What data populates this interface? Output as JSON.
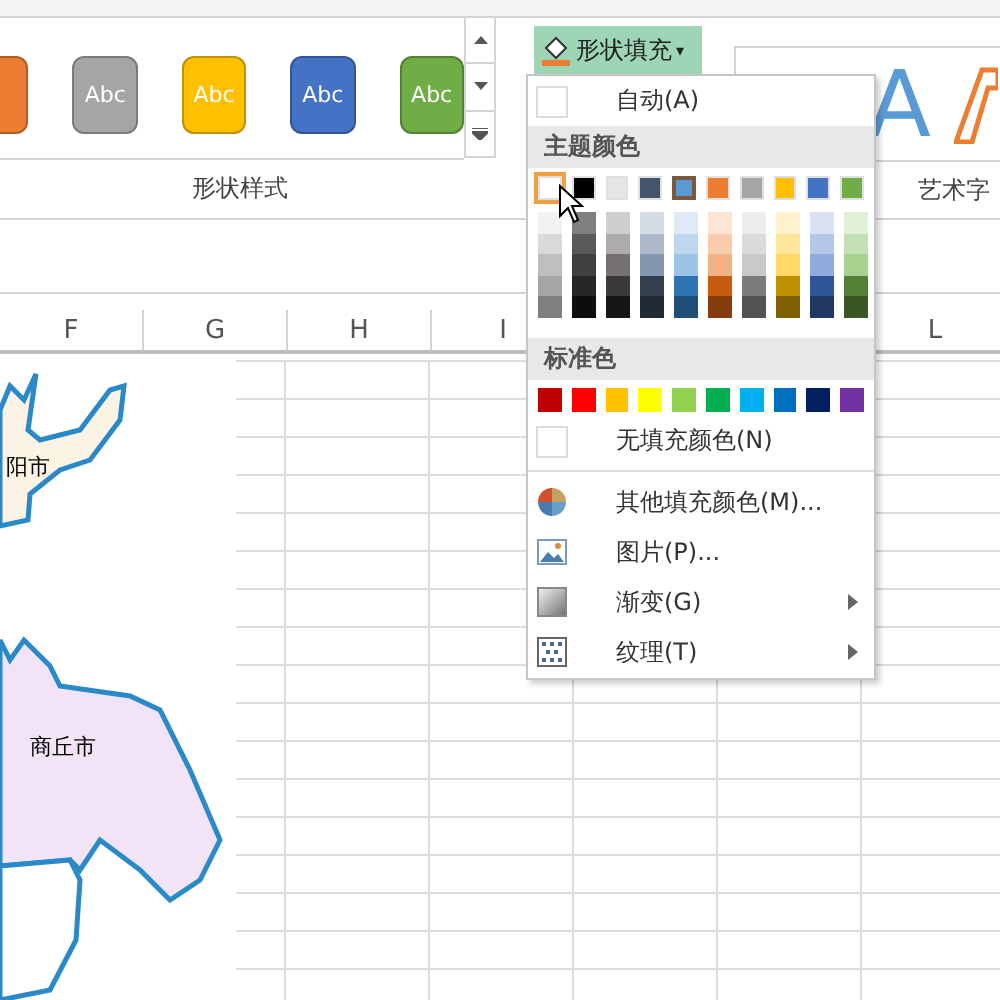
{
  "ribbon": {
    "style_gallery": [
      {
        "color": "#ed7d31"
      },
      {
        "color": "#a5a5a5",
        "label": "Abc"
      },
      {
        "color": "#ffc000",
        "label": "Abc"
      },
      {
        "color": "#4472c4",
        "label": "Abc"
      },
      {
        "color": "#70ad47",
        "label": "Abc"
      }
    ],
    "shape_styles_label": "形状样式",
    "fill_button": {
      "label": "形状填充",
      "caret": "▾",
      "expanded": true
    },
    "wordart": [
      {
        "label": "A",
        "color": "#5b9bd5"
      },
      {
        "color": "#ed7d31"
      }
    ],
    "wordart_label": "艺术字"
  },
  "sheet": {
    "columns": [
      {
        "label": "F"
      },
      {
        "label": "G"
      },
      {
        "label": "H"
      },
      {
        "label": "I"
      },
      {},
      {},
      {
        "label": "L"
      }
    ],
    "map_labels": [
      "阳市",
      "商丘市"
    ]
  },
  "fill_menu": {
    "auto": "自动(A)",
    "theme_header": "主题颜色",
    "theme_colors": [
      {
        "color": "#ffffff",
        "selected": true,
        "current": false,
        "shades": [
          {
            "color": "#f2f2f2"
          },
          {
            "color": "#d9d9d9"
          },
          {
            "color": "#bfbfbf"
          },
          {
            "color": "#a6a6a6"
          },
          {
            "color": "#808080"
          }
        ]
      },
      {
        "color": "#000000",
        "selected": false,
        "current": false,
        "shades": [
          {
            "color": "#7f7f7f"
          },
          {
            "color": "#595959"
          },
          {
            "color": "#404040"
          },
          {
            "color": "#262626"
          },
          {
            "color": "#0d0d0d"
          }
        ]
      },
      {
        "color": "#e7e6e6",
        "selected": false,
        "current": false,
        "shades": [
          {
            "color": "#d0cece"
          },
          {
            "color": "#aeabab"
          },
          {
            "color": "#757171"
          },
          {
            "color": "#3b3838"
          },
          {
            "color": "#171616"
          }
        ]
      },
      {
        "color": "#44546a",
        "selected": false,
        "current": false,
        "shades": [
          {
            "color": "#d6dce4"
          },
          {
            "color": "#adb9ca"
          },
          {
            "color": "#8497b0"
          },
          {
            "color": "#333f4f"
          },
          {
            "color": "#222a35"
          }
        ]
      },
      {
        "color": "#5b9bd5",
        "selected": false,
        "current": true,
        "shades": [
          {
            "color": "#deebf6"
          },
          {
            "color": "#bdd7ee"
          },
          {
            "color": "#9dc3e6"
          },
          {
            "color": "#2e75b5"
          },
          {
            "color": "#1f4e79"
          }
        ]
      },
      {
        "color": "#ed7d31",
        "selected": false,
        "current": false,
        "shades": [
          {
            "color": "#fbe5d5"
          },
          {
            "color": "#f7cbac"
          },
          {
            "color": "#f4b183"
          },
          {
            "color": "#c55a11"
          },
          {
            "color": "#843c0b"
          }
        ]
      },
      {
        "color": "#a5a5a5",
        "selected": false,
        "current": false,
        "shades": [
          {
            "color": "#ededed"
          },
          {
            "color": "#dbdbdb"
          },
          {
            "color": "#c9c9c9"
          },
          {
            "color": "#7b7b7b"
          },
          {
            "color": "#525252"
          }
        ]
      },
      {
        "color": "#ffc000",
        "selected": false,
        "current": false,
        "shades": [
          {
            "color": "#fff2cc"
          },
          {
            "color": "#ffe699"
          },
          {
            "color": "#ffd966"
          },
          {
            "color": "#bf9000"
          },
          {
            "color": "#7f6000"
          }
        ]
      },
      {
        "color": "#4472c4",
        "selected": false,
        "current": false,
        "shades": [
          {
            "color": "#dae3f3"
          },
          {
            "color": "#b4c7e7"
          },
          {
            "color": "#8faadc"
          },
          {
            "color": "#2f5597"
          },
          {
            "color": "#203864"
          }
        ]
      },
      {
        "color": "#70ad47",
        "selected": false,
        "current": false,
        "shades": [
          {
            "color": "#e2f0d9"
          },
          {
            "color": "#c5e0b4"
          },
          {
            "color": "#a9d18e"
          },
          {
            "color": "#538135"
          },
          {
            "color": "#385723"
          }
        ]
      }
    ],
    "standard_header": "标准色",
    "standard_colors": [
      {
        "color": "#c00000"
      },
      {
        "color": "#ff0000"
      },
      {
        "color": "#ffc000"
      },
      {
        "color": "#ffff00"
      },
      {
        "color": "#92d050"
      },
      {
        "color": "#00b050"
      },
      {
        "color": "#00b0f0"
      },
      {
        "color": "#0070c0"
      },
      {
        "color": "#002060"
      },
      {
        "color": "#7030a0"
      }
    ],
    "no_fill": "无填充颜色(N)",
    "items": [
      {
        "kind": "palette",
        "label": "其他填充颜色(M)...",
        "submenu": false
      },
      {
        "kind": "picture",
        "label": "图片(P)...",
        "submenu": false
      },
      {
        "kind": "gradient",
        "label": "渐变(G)",
        "submenu": true
      },
      {
        "kind": "texture",
        "label": "纹理(T)",
        "submenu": true
      }
    ]
  }
}
